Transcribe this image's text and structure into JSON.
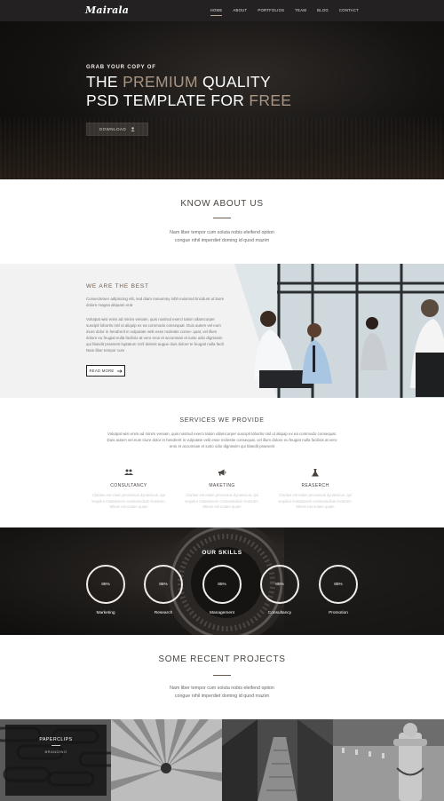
{
  "brand": {
    "logo": "Mairala"
  },
  "nav": {
    "items": [
      "HOME",
      "ABOUT",
      "PORTFOLIOS",
      "TEAM",
      "BLOG",
      "CONTACT"
    ],
    "active": "HOME"
  },
  "hero": {
    "pre": "GRAB YOUR COPY OF",
    "line1_a": "THE",
    "line1_b": "PREMIUM",
    "line1_c": "QUALITY",
    "line2_a": "PSD TEMPLATE FOR",
    "line2_b": "FREE",
    "button": "DOWNLOAD"
  },
  "know": {
    "title": "KNOW ABOUT US",
    "text1": "Nam liber tempor cum soluta nobis eleifend option",
    "text2": "congue nihil imperdiet doming id quod mazim"
  },
  "best": {
    "title": "WE ARE THE BEST",
    "p1": "Consectetuer adipiscing elit, sed diam nonummy nibh euismod tincidunt ut laoreet dolore magna aliquam erat",
    "p2": "Volutpat wisi enim ad minim veniam, quis nostrud exerci tation ullamcorper suscipit lobortis nisl ut aliquip ex ea commodo consequat. Duis autem vel eum iriure dolor in hendrerit in vulputate velit esse molestie conse- quat, vel illum dolore eu feugiat nulla facilisis at vero eros et accumsan et iusto odio dignissim qui blandit praesent luptatum zzril delenit augue duis dolore te feugait nulla facilisi. Nam liber tempor cum",
    "button": "READ MORE"
  },
  "services": {
    "title": "SERVICES WE PROVIDE",
    "intro": "Volutpat wisi enim ad minim veniam, quis nostrud exerci tation ullamcorper suscipit lobortis nisl ut aliquip ex ea commodo consequat. Duis autem vel eum iriure dolor in hendrerit in vulputate velit esse molestie consequat, vel illum dolore eu feugiat nulla facilisis at vero eros et accumsan et iusto odio dignissim qui blandit praesent",
    "items": [
      {
        "name": "CONSULTANCY",
        "icon": "people-icon",
        "desc": "Claritas est etiam processus dynamicus, qui sequitur mutationem consuetudium lectorum. Mirum est notare quam"
      },
      {
        "name": "MAKETING",
        "icon": "megaphone-icon",
        "desc": "Claritas est etiam processus dynamicus, qui sequitur mutationem consuetudium lectorum. Mirum est notare quam"
      },
      {
        "name": "REASERCH",
        "icon": "flask-icon",
        "desc": "Claritas est etiam processus dynamicus, qui sequitur mutationem consuetudium lectorum. Mirum est notare quam"
      }
    ]
  },
  "skills": {
    "title": "OUR SKILLS",
    "items": [
      {
        "name": "Marketing",
        "value": "85%"
      },
      {
        "name": "Research",
        "value": "85%"
      },
      {
        "name": "Management",
        "value": "85%"
      },
      {
        "name": "Consultancy",
        "value": "85%"
      },
      {
        "name": "Promotion",
        "value": "85%"
      }
    ]
  },
  "recent": {
    "title": "SOME RECENT PROJECTS",
    "text1": "Nam liber tempor cum soluta nobis eleifend option",
    "text2": "congue nihil imperdiet doming id quod mazim"
  },
  "projects": {
    "featured_title": "PAPERCLIPS",
    "featured_category": "BRANDING",
    "tiles": [
      "paperclips-photo",
      "pencils-photo",
      "boardwalk-photo",
      "hydrant-photo"
    ]
  }
}
